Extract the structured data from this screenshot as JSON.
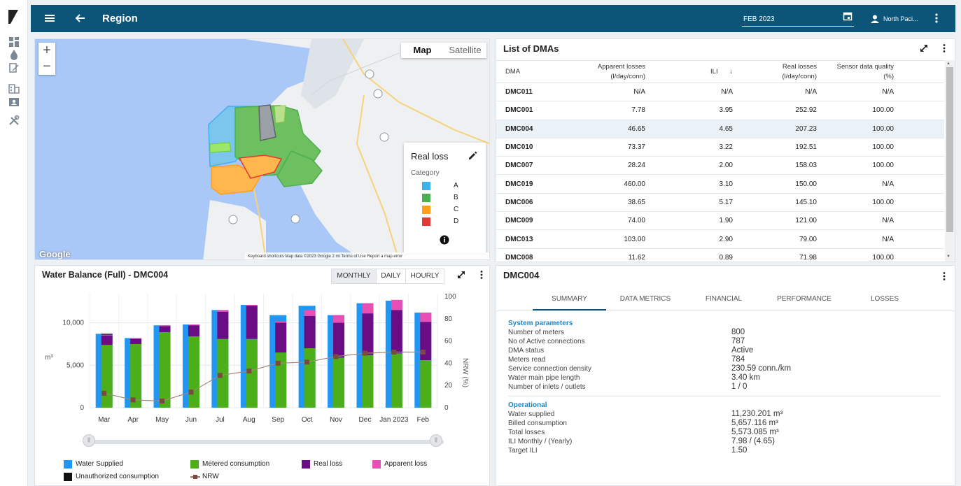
{
  "header": {
    "title": "Region",
    "date": "FEB 2023",
    "user": "North Paci..."
  },
  "map": {
    "type_options": [
      {
        "label": "Map",
        "active": true
      },
      {
        "label": "Satellite",
        "active": false
      }
    ],
    "google_label": "Google",
    "attribution": "Keyboard shortcuts   Map data ©2023 Google   2 mi   Terms of Use   Report a map error",
    "legend": {
      "title": "Real loss",
      "category_label": "Category",
      "items": [
        {
          "label": "A",
          "color": "#3fb1ea"
        },
        {
          "label": "B",
          "color": "#4caf50"
        },
        {
          "label": "C",
          "color": "#ff9f1c"
        },
        {
          "label": "D",
          "color": "#e53935"
        }
      ]
    }
  },
  "dma_list": {
    "title": "List of DMAs",
    "columns": [
      {
        "line1": "DMA",
        "line2": ""
      },
      {
        "line1": "Apparent losses",
        "line2": "(l/day/conn)"
      },
      {
        "line1": "ILI",
        "line2": ""
      },
      {
        "line1": "Real losses",
        "line2": "(l/day/conn)"
      },
      {
        "line1": "Sensor data quality",
        "line2": "(%)"
      }
    ],
    "rows": [
      {
        "dma": "DMC011",
        "apparent": "N/A",
        "ili": "N/A",
        "real": "N/A",
        "quality": "N/A"
      },
      {
        "dma": "DMC001",
        "apparent": "7.78",
        "ili": "3.95",
        "real": "252.92",
        "quality": "100.00"
      },
      {
        "dma": "DMC004",
        "apparent": "46.65",
        "ili": "4.65",
        "real": "207.23",
        "quality": "100.00",
        "selected": true
      },
      {
        "dma": "DMC010",
        "apparent": "73.37",
        "ili": "3.22",
        "real": "192.51",
        "quality": "100.00"
      },
      {
        "dma": "DMC007",
        "apparent": "28.24",
        "ili": "2.00",
        "real": "158.03",
        "quality": "100.00"
      },
      {
        "dma": "DMC019",
        "apparent": "460.00",
        "ili": "3.10",
        "real": "150.00",
        "quality": "N/A"
      },
      {
        "dma": "DMC006",
        "apparent": "38.65",
        "ili": "5.17",
        "real": "145.10",
        "quality": "100.00"
      },
      {
        "dma": "DMC009",
        "apparent": "74.00",
        "ili": "1.90",
        "real": "121.00",
        "quality": "N/A"
      },
      {
        "dma": "DMC013",
        "apparent": "103.00",
        "ili": "2.90",
        "real": "79.00",
        "quality": "N/A"
      },
      {
        "dma": "DMC008",
        "apparent": "11.62",
        "ili": "0.89",
        "real": "71.98",
        "quality": "100.00"
      }
    ]
  },
  "water_balance": {
    "title": "Water Balance (Full) - DMC004",
    "periods": [
      {
        "label": "MONTHLY",
        "active": true
      },
      {
        "label": "DAILY",
        "active": false
      },
      {
        "label": "HOURLY",
        "active": false
      }
    ],
    "legend": [
      {
        "label": "Water Supplied",
        "color": "#2196f3",
        "kind": "box"
      },
      {
        "label": "Metered consumption",
        "color": "#4caf1a",
        "kind": "box"
      },
      {
        "label": "Real loss",
        "color": "#6a0c84",
        "kind": "box"
      },
      {
        "label": "Apparent loss",
        "color": "#e84fb4",
        "kind": "box"
      },
      {
        "label": "Unauthorized consumption",
        "color": "#111111",
        "kind": "box"
      },
      {
        "label": "NRW",
        "color": "#7b4a3c",
        "kind": "line"
      }
    ]
  },
  "chart_data": {
    "type": "bar",
    "categories": [
      "Mar",
      "Apr",
      "May",
      "Jun",
      "Jul",
      "Aug",
      "Sep",
      "Oct",
      "Nov",
      "Dec",
      "Jan 2023",
      "Feb"
    ],
    "series": [
      {
        "name": "Water Supplied",
        "values": [
          8700,
          8200,
          9700,
          9800,
          11500,
          12100,
          10900,
          12000,
          10900,
          12300,
          12600,
          11200
        ]
      },
      {
        "name": "Metered consumption",
        "values": [
          7400,
          7500,
          8900,
          8400,
          8100,
          8100,
          6500,
          7000,
          5900,
          6200,
          6400,
          5600
        ]
      },
      {
        "name": "Real loss",
        "values": [
          1100,
          600,
          700,
          1300,
          3200,
          3900,
          3500,
          3800,
          4100,
          4900,
          5100,
          4500
        ]
      },
      {
        "name": "Apparent loss",
        "values": [
          100,
          100,
          100,
          100,
          200,
          100,
          200,
          700,
          900,
          1200,
          1200,
          1100
        ]
      },
      {
        "name": "Unauthorized consumption",
        "values": [
          100,
          0,
          0,
          0,
          0,
          0,
          0,
          0,
          0,
          0,
          0,
          0
        ]
      },
      {
        "name": "NRW",
        "values": [
          13,
          7,
          6,
          14,
          29,
          33,
          40,
          41,
          46,
          49,
          50,
          50
        ]
      }
    ],
    "ylabel": "m³",
    "y2label": "NRW (%)",
    "yticks": [
      0,
      5000,
      10000
    ],
    "ytick_labels": [
      "0",
      "5,000",
      "10,000"
    ],
    "ylim": [
      0,
      12600
    ],
    "y2ticks": [
      0,
      20,
      40,
      60,
      80,
      100
    ],
    "y2lim": [
      0,
      100
    ],
    "grid": true
  },
  "dma_info": {
    "title": "DMC004",
    "tabs": [
      {
        "label": "SUMMARY",
        "active": true
      },
      {
        "label": "DATA METRICS",
        "active": false
      },
      {
        "label": "FINANCIAL",
        "active": false
      },
      {
        "label": "PERFORMANCE",
        "active": false
      },
      {
        "label": "LOSSES",
        "active": false
      }
    ],
    "system": {
      "heading": "System parameters",
      "rows": [
        {
          "label": "Number of meters",
          "value": "800"
        },
        {
          "label": "No of Active connections",
          "value": "787"
        },
        {
          "label": "DMA status",
          "value": "Active"
        },
        {
          "label": "Meters read",
          "value": "784"
        },
        {
          "label": "Service connection density",
          "value": "230.59 conn./km"
        },
        {
          "label": "Water main pipe length",
          "value": "3.40 km"
        },
        {
          "label": "Number of inlets / outlets",
          "value": "1 / 0"
        }
      ]
    },
    "operational": {
      "heading": "Operational",
      "rows": [
        {
          "label": "Water supplied",
          "value": "11,230.201 m³"
        },
        {
          "label": "Billed consumption",
          "value": "5,657.116 m³"
        },
        {
          "label": "Total losses",
          "value": "5,573.085 m³"
        },
        {
          "label": "ILI Monthly / (Yearly)",
          "value": "7.98 / (4.65)"
        },
        {
          "label": "Target ILI",
          "value": "1.50"
        }
      ]
    }
  }
}
